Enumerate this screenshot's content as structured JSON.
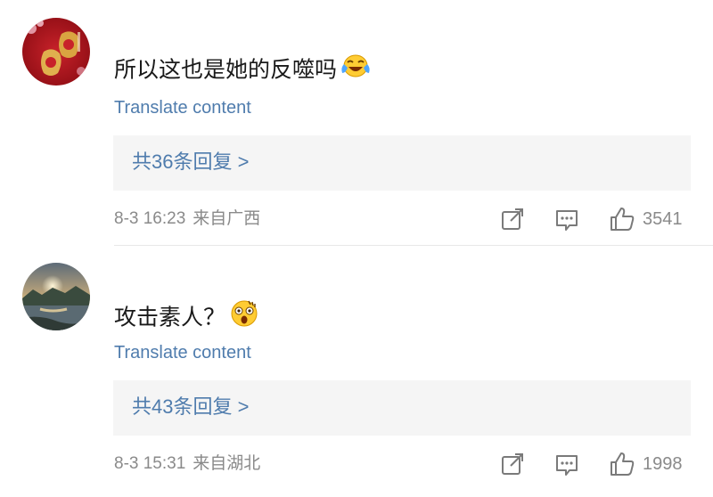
{
  "comments": [
    {
      "text": "所以这也是她的反噬吗",
      "emoji": "laughing-tears-emoji",
      "translate_label": "Translate content",
      "replies_label": "共36条回复 >",
      "time": "8-3 16:23",
      "location": "来自广西",
      "likes": "3541",
      "avatar": "red-fortune-bag-avatar"
    },
    {
      "text": "攻击素人？",
      "emoji": "shocked-face-emoji",
      "translate_label": "Translate content",
      "replies_label": "共43条回复 >",
      "time": "8-3 15:31",
      "location": "来自湖北",
      "likes": "1998",
      "avatar": "lake-sunset-avatar"
    }
  ],
  "icons": {
    "share": "share-icon",
    "reply": "comment-icon",
    "like": "thumbs-up-icon"
  },
  "colors": {
    "link": "#4f7cad",
    "meta": "#8a8a8a",
    "reply_box": "#f5f5f5"
  }
}
